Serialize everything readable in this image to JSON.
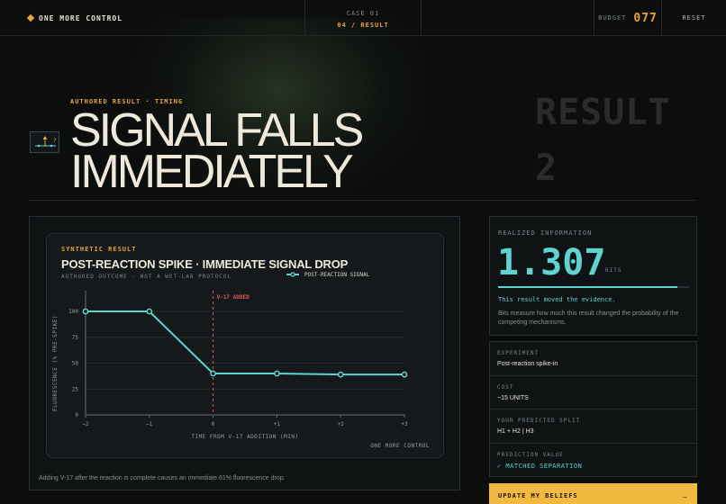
{
  "app": {
    "brand": "ONE MORE CONTROL"
  },
  "header": {
    "case_line1": "CASE 01",
    "case_line2": "04 / RESULT",
    "budget_label": "BUDGET",
    "budget_value": "077",
    "reset_label": "RESET"
  },
  "hero": {
    "eyebrow": "AUTHORED RESULT · TIMING",
    "title_line1": "SIGNAL FALLS",
    "title_line2": "IMMEDIATELY",
    "ghost_line1": "RESULT",
    "ghost_line2": "2",
    "icon": "timing-chart-icon"
  },
  "chart_card": {
    "eyebrow": "SYNTHETIC RESULT",
    "title": "POST-REACTION SPIKE · IMMEDIATE SIGNAL DROP",
    "subtitle": "AUTHORED OUTCOME · NOT A WET-LAB PROTOCOL",
    "watermark": "ONE MORE CONTROL",
    "caption": "Adding V-17 after the reaction is complete causes an immediate 61% fluorescence drop."
  },
  "chart_data": {
    "type": "line",
    "title": "POST-REACTION SPIKE · IMMEDIATE SIGNAL DROP",
    "xlabel": "TIME FROM V-17 ADDITION (MIN)",
    "ylabel": "FLUORESCENCE (% PRE-SPIKE)",
    "x": [
      -2,
      -1,
      0,
      1,
      2,
      3
    ],
    "x_tick_labels": [
      "−2",
      "−1",
      "0",
      "+1",
      "+2",
      "+3"
    ],
    "xlim": [
      -2,
      3
    ],
    "ylim": [
      0,
      100
    ],
    "y_ticks": [
      0,
      25,
      50,
      75,
      100
    ],
    "grid": true,
    "legend_position": "top-right",
    "series": [
      {
        "name": "POST-REACTION SIGNAL",
        "values": [
          100,
          100,
          40,
          40,
          39,
          39
        ],
        "color": "#5fd3cf"
      }
    ],
    "annotations": [
      {
        "x": 0,
        "label": "V-17 ADDED",
        "color": "#e05a5a"
      }
    ]
  },
  "result": {
    "label": "REALIZED INFORMATION",
    "value": "1.307",
    "unit": "BITS",
    "fill_fraction": 0.94,
    "moved_text": "This result moved the evidence.",
    "description": "Bits measure how much this result changed the probability of the competing mechanisms."
  },
  "details": [
    {
      "label": "EXPERIMENT",
      "value": "Post-reaction spike-in"
    },
    {
      "label": "COST",
      "value": "−15 UNITS"
    },
    {
      "label": "YOUR PREDICTED SPLIT",
      "value": "H1 + H2 | H3"
    },
    {
      "label": "PREDICTION VALUE",
      "value": "✓ MATCHED SEPARATION"
    }
  ],
  "cta": {
    "label": "UPDATE MY BELIEFS",
    "arrow": "→"
  },
  "colors": {
    "accent": "#e6a53a",
    "teal": "#5fd3cf",
    "marker": "#e05a5a",
    "cta": "#f2b941"
  }
}
